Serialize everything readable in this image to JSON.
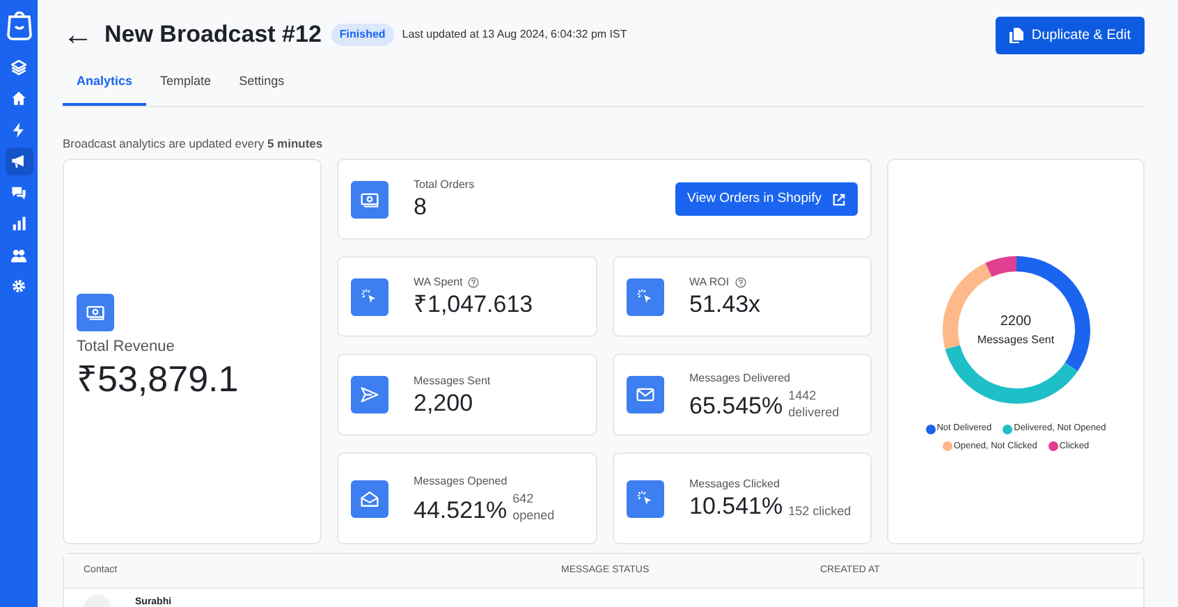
{
  "sidebar": {
    "items": [
      {
        "kind": "layers",
        "selected": false
      },
      {
        "kind": "home",
        "selected": false
      },
      {
        "kind": "bolt",
        "selected": false
      },
      {
        "kind": "megaphone",
        "selected": true
      },
      {
        "kind": "chat",
        "selected": false
      },
      {
        "kind": "chart",
        "selected": false
      },
      {
        "kind": "users",
        "selected": false
      },
      {
        "kind": "gear",
        "selected": false
      }
    ]
  },
  "header": {
    "back": "←",
    "title": "New Broadcast #12",
    "status": "Finished",
    "updated": "Last updated at 13 Aug 2024, 6:04:32 pm IST",
    "action": "Duplicate & Edit"
  },
  "tabs": [
    {
      "label": "Analytics",
      "selected": true
    },
    {
      "label": "Template",
      "selected": false
    },
    {
      "label": "Settings",
      "selected": false
    }
  ],
  "note": "Broadcast analytics are updated every **5 minutes**",
  "revenue": {
    "label": "Total Revenue",
    "value": "₹53,879.1"
  },
  "orders": {
    "label": "Total Orders",
    "value": "8",
    "button": "View Orders in Shopify"
  },
  "metrics": [
    {
      "kind": "pointer",
      "label": "WA Spent",
      "help": true,
      "value": "₹1,047.613"
    },
    {
      "kind": "pointer",
      "label": "WA ROI",
      "help": true,
      "value": "51.43x"
    },
    {
      "kind": "send",
      "label": "Messages Sent",
      "help": false,
      "value": "2,200"
    },
    {
      "kind": "mail",
      "label": "Messages Delivered",
      "help": false,
      "value": "65.545%",
      "note": "1442 delivered",
      "stacked": true
    },
    {
      "kind": "openmail",
      "label": "Messages Opened",
      "help": false,
      "value": "44.521%",
      "note": "642 opened",
      "stacked": true
    },
    {
      "kind": "pointer",
      "label": "Messages Clicked",
      "help": false,
      "value": "10.541%",
      "note": "152 clicked",
      "stacked": false
    }
  ],
  "donut": {
    "total": "2200",
    "caption": "Messages Sent",
    "chart_data": {
      "type": "donut",
      "categories": [
        "Not Delivered",
        "Delivered, Not Opened",
        "Opened, Not Clicked",
        "Clicked"
      ],
      "values": [
        34.45,
        36.36,
        22.27,
        6.92
      ],
      "colors": [
        "#1a64f0",
        "#1fbfc8",
        "#fdb98a",
        "#e0408f"
      ]
    }
  },
  "table": {
    "columns": [
      "Contact",
      "MESSAGE STATUS",
      "CREATED AT"
    ],
    "rows": [
      {
        "contact": "Surabhi"
      }
    ]
  }
}
